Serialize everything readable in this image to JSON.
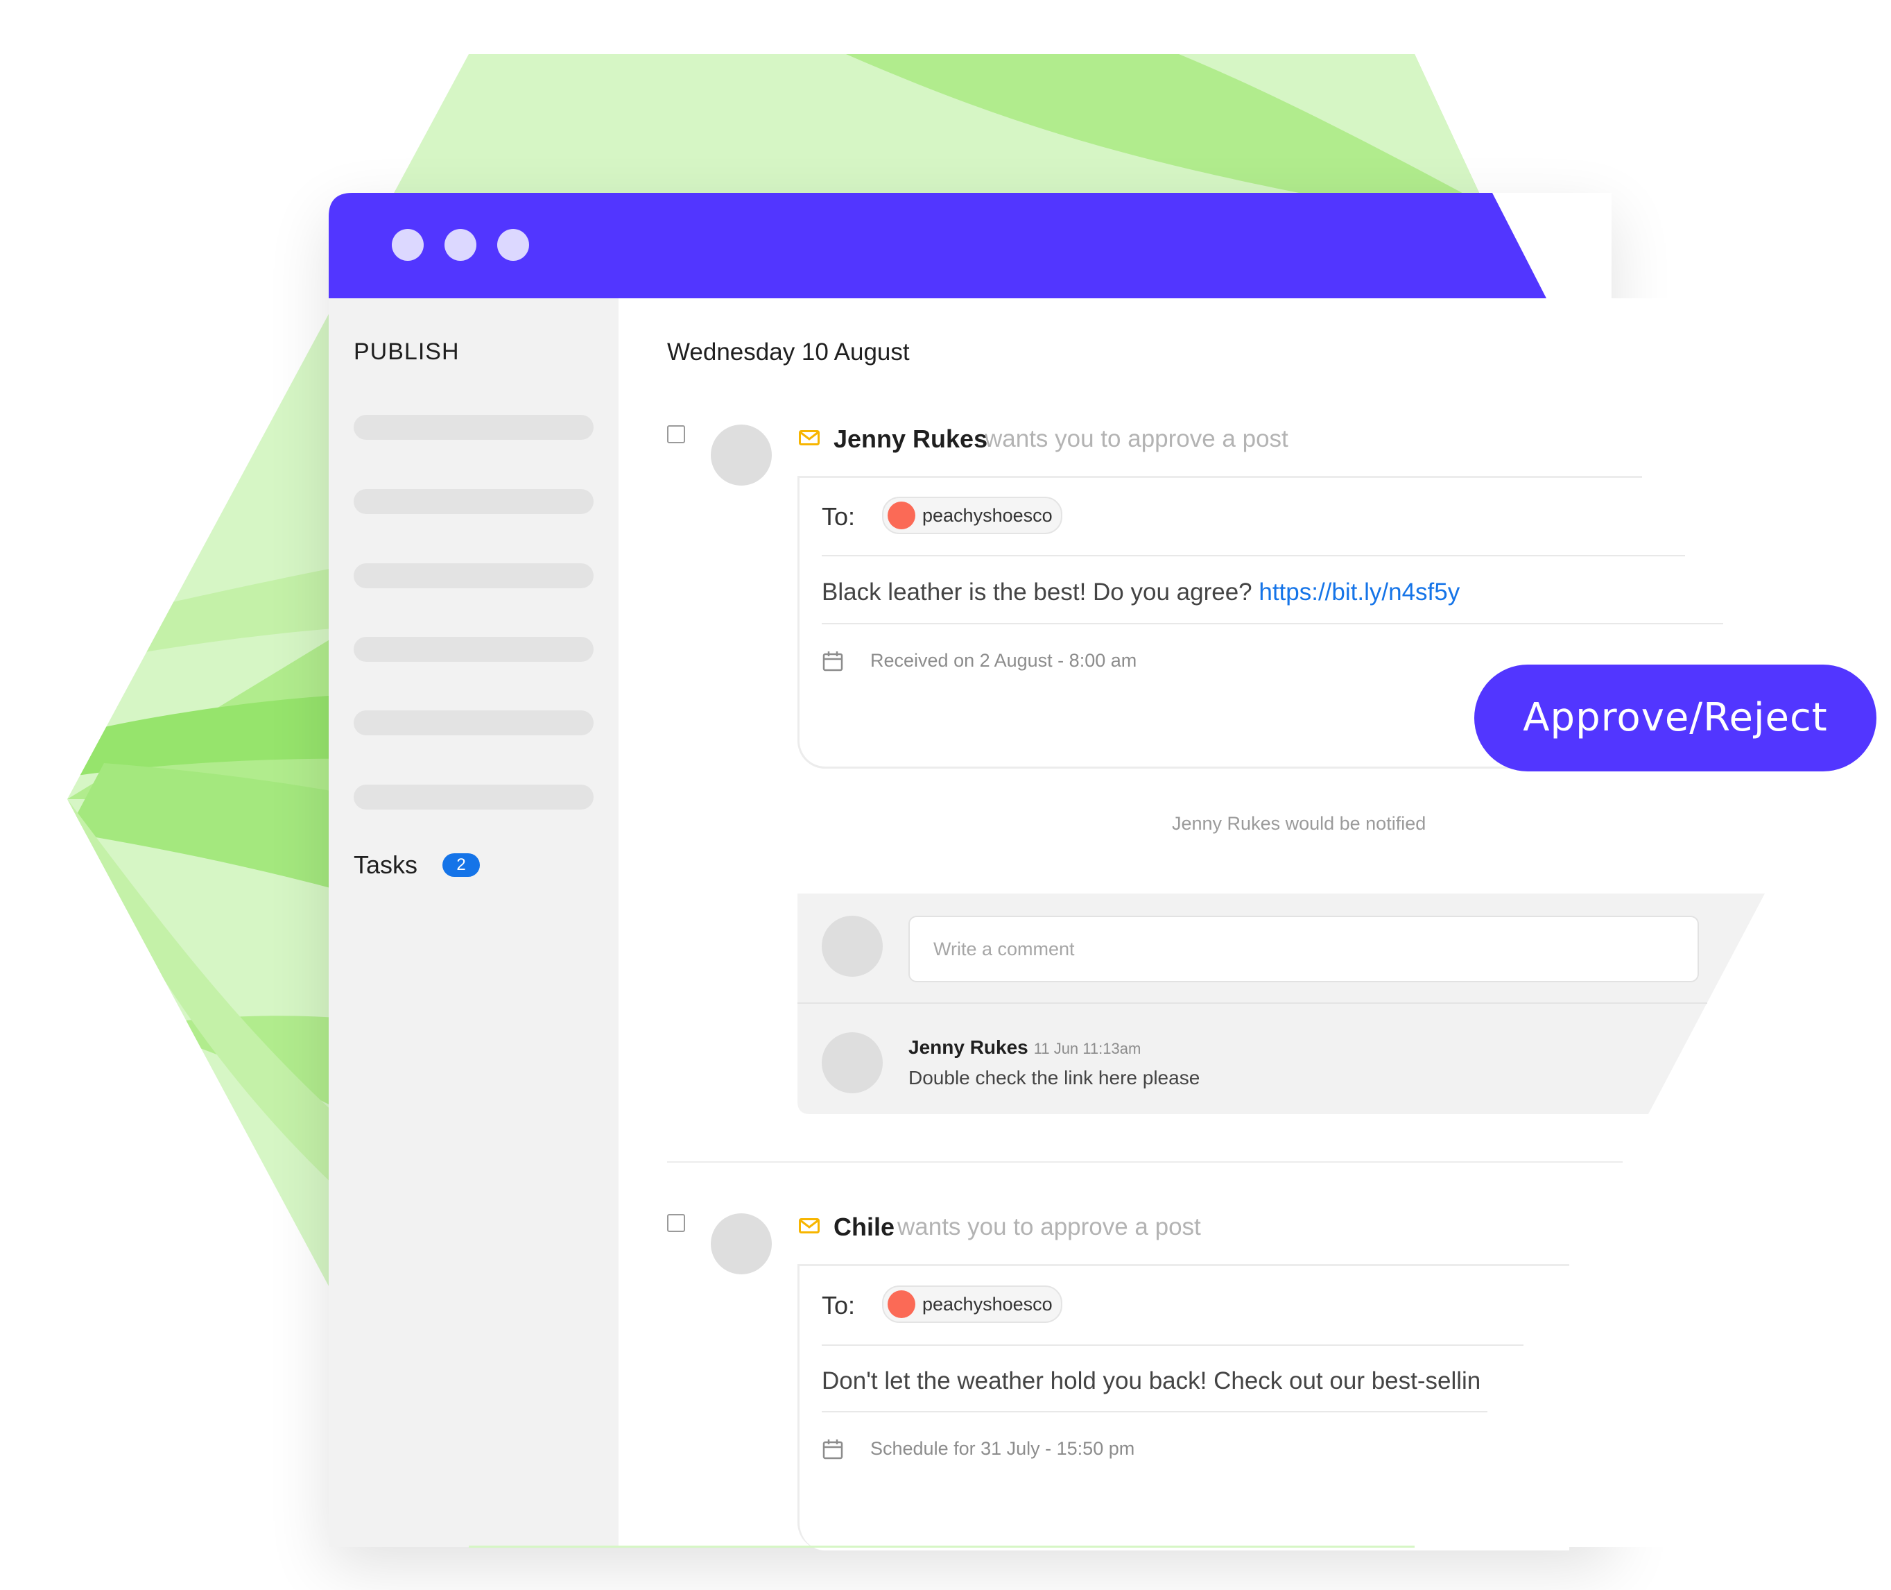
{
  "colors": {
    "titlebar": "#5236ff",
    "accent_button": "#5236ff",
    "badge": "#1574e8",
    "link": "#1574e8",
    "account_avatar": "#fb6a56",
    "mail_icon": "#f7b500",
    "background_shape": "#b5ed8f"
  },
  "window": {
    "controls": [
      "window-dot",
      "window-dot",
      "window-dot"
    ]
  },
  "sidebar": {
    "title": "PUBLISH",
    "tasks_label": "Tasks",
    "tasks_count": "2"
  },
  "main": {
    "date_heading": "Wednesday 10 August"
  },
  "posts": [
    {
      "author": "Jenny Rukes",
      "action_text": "wants you to approve a post",
      "to_label": "To:",
      "account": "peachyshoesco",
      "text": "Black leather is the best! Do you agree? ",
      "link": "https://bit.ly/n4sf5y",
      "meta_icon": "calendar-icon",
      "meta": "Received on 2 August - 8:00 am"
    },
    {
      "author": "Chile",
      "action_text": "wants you to approve a post",
      "to_label": "To:",
      "account": "peachyshoesco",
      "text": "Don't let the weather hold you back! Check out our best-sellin",
      "meta_icon": "calendar-icon",
      "meta": "Schedule for 31 July - 15:50 pm"
    }
  ],
  "approve_button": "Approve/Reject",
  "notification_text": "Jenny Rukes would be notified",
  "comments": {
    "placeholder": "Write a comment",
    "items": [
      {
        "author": "Jenny Rukes",
        "time": "11 Jun 11:13am",
        "text": "Double check the link here please"
      }
    ]
  }
}
